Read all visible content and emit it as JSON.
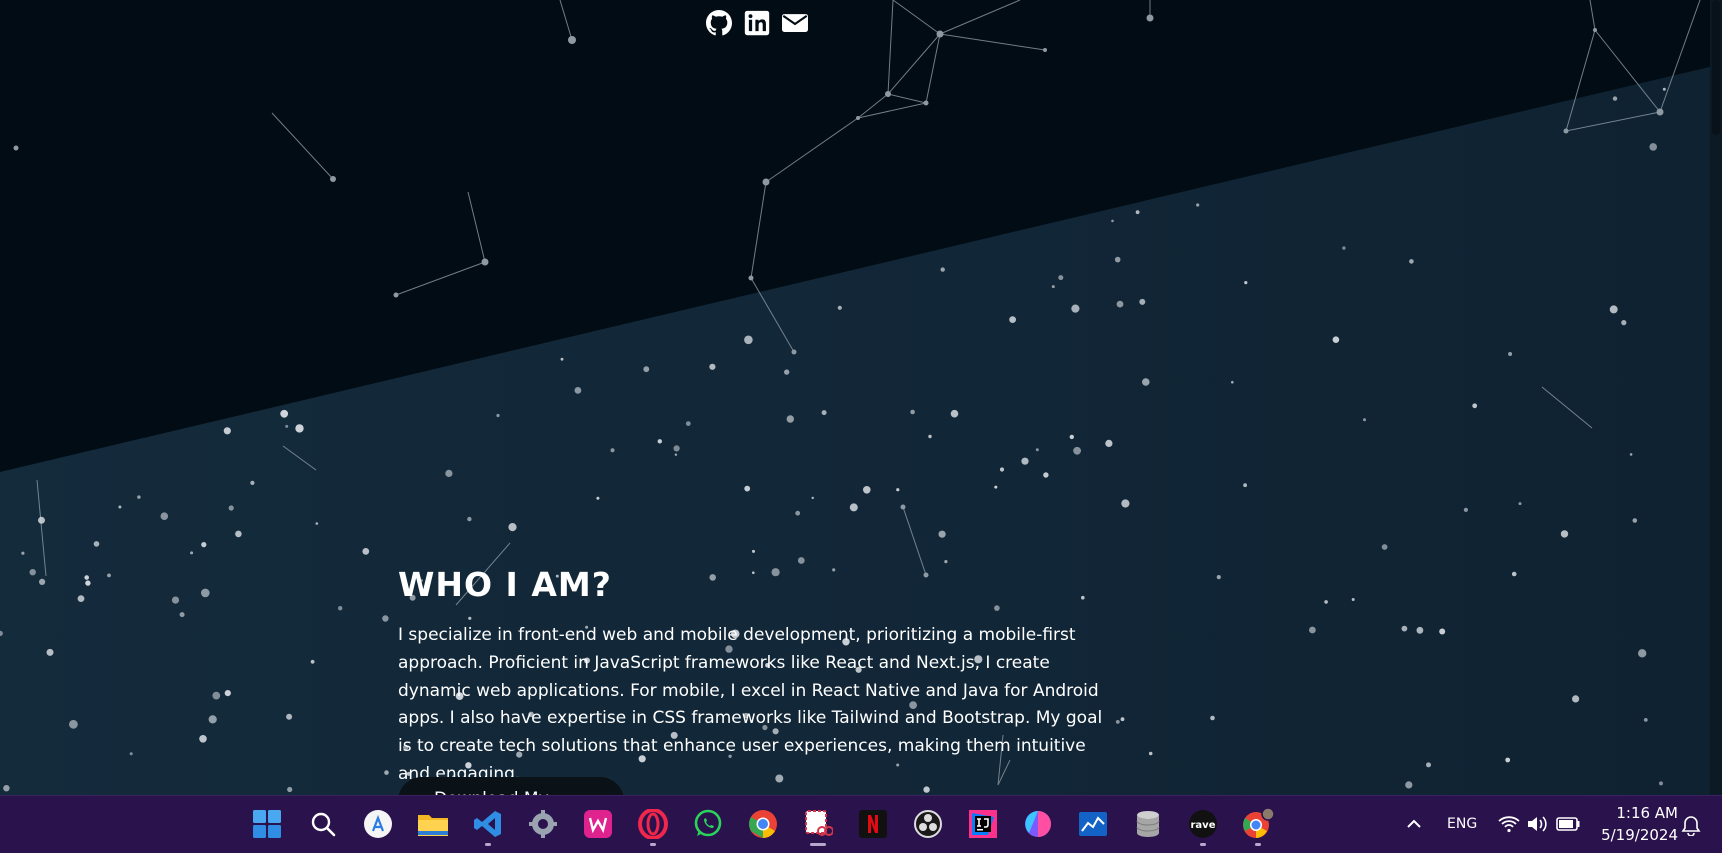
{
  "about": {
    "title": "WHO I AM?",
    "description": "I specialize in front-end web and mobile development, prioritizing a mobile-first approach. Proficient in JavaScript frameworks like React and Next.js, I create dynamic web applications. For mobile, I excel in React Native and Java for Android apps. I also have expertise in CSS frameworks like Tailwind and Bootstrap. My goal is to create tech solutions that enhance user experiences, making them intuitive and engaging.",
    "button_label": "Download My Resume"
  },
  "social_links": [
    {
      "icon": "github-icon"
    },
    {
      "icon": "linkedin-icon"
    },
    {
      "icon": "mail-icon"
    }
  ],
  "colors": {
    "background_dark": "#020c14",
    "background_band": "#12293a",
    "taskbar": "#2a124d"
  },
  "taskbar": {
    "apps": [
      {
        "name": "start-icon"
      },
      {
        "name": "search-icon"
      },
      {
        "name": "app-store-icon"
      },
      {
        "name": "file-explorer-icon"
      },
      {
        "name": "vscode-icon"
      },
      {
        "name": "settings-icon"
      },
      {
        "name": "wamp-icon"
      },
      {
        "name": "opera-icon"
      },
      {
        "name": "whatsapp-icon"
      },
      {
        "name": "chrome-icon"
      },
      {
        "name": "snipping-tool-icon"
      },
      {
        "name": "netflix-icon"
      },
      {
        "name": "obs-icon"
      },
      {
        "name": "intellij-icon"
      },
      {
        "name": "color-app-icon"
      },
      {
        "name": "stock-chart-icon"
      },
      {
        "name": "database-icon"
      },
      {
        "name": "rave-icon"
      },
      {
        "name": "chrome-profile-icon"
      }
    ],
    "tray": {
      "language": "ENG",
      "time": "1:16 AM",
      "date": "5/19/2024"
    }
  }
}
